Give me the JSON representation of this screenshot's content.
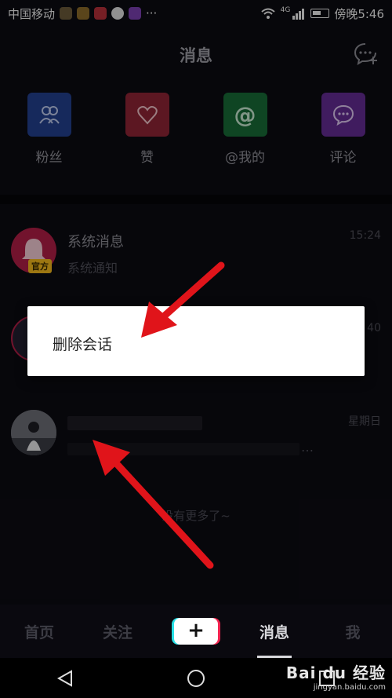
{
  "status_bar": {
    "carrier": "中国移动",
    "more_dots": "···",
    "signal": "4G",
    "time": "傍晚5:46"
  },
  "header": {
    "title": "消息"
  },
  "quick_actions": [
    {
      "label": "粉丝",
      "icon": "fans-icon",
      "color": "#2a55c0"
    },
    {
      "label": "赞",
      "icon": "heart-icon",
      "color": "#c0334a"
    },
    {
      "label": "@我的",
      "icon": "at-icon",
      "color": "#1f9a4a"
    },
    {
      "label": "评论",
      "icon": "comment-icon",
      "color": "#8d3fd0"
    }
  ],
  "conversations": [
    {
      "name": "系统消息",
      "subtitle": "系统通知",
      "time": "15:24",
      "badge": "官方"
    },
    {
      "name": "",
      "subtitle": "",
      "time": "40"
    },
    {
      "name": "",
      "subtitle": "…",
      "time": "星期日"
    }
  ],
  "no_more_text": "没有更多了~",
  "context_menu": {
    "items": [
      "删除会话"
    ]
  },
  "tab_bar": {
    "tabs": [
      "首页",
      "关注",
      "+",
      "消息",
      "我"
    ],
    "active": "消息"
  },
  "watermark": {
    "brand": "Bai du 经验",
    "url": "jingyan.baidu.com"
  },
  "colors": {
    "background": "#0c0b12",
    "arrow": "#e0141a"
  }
}
